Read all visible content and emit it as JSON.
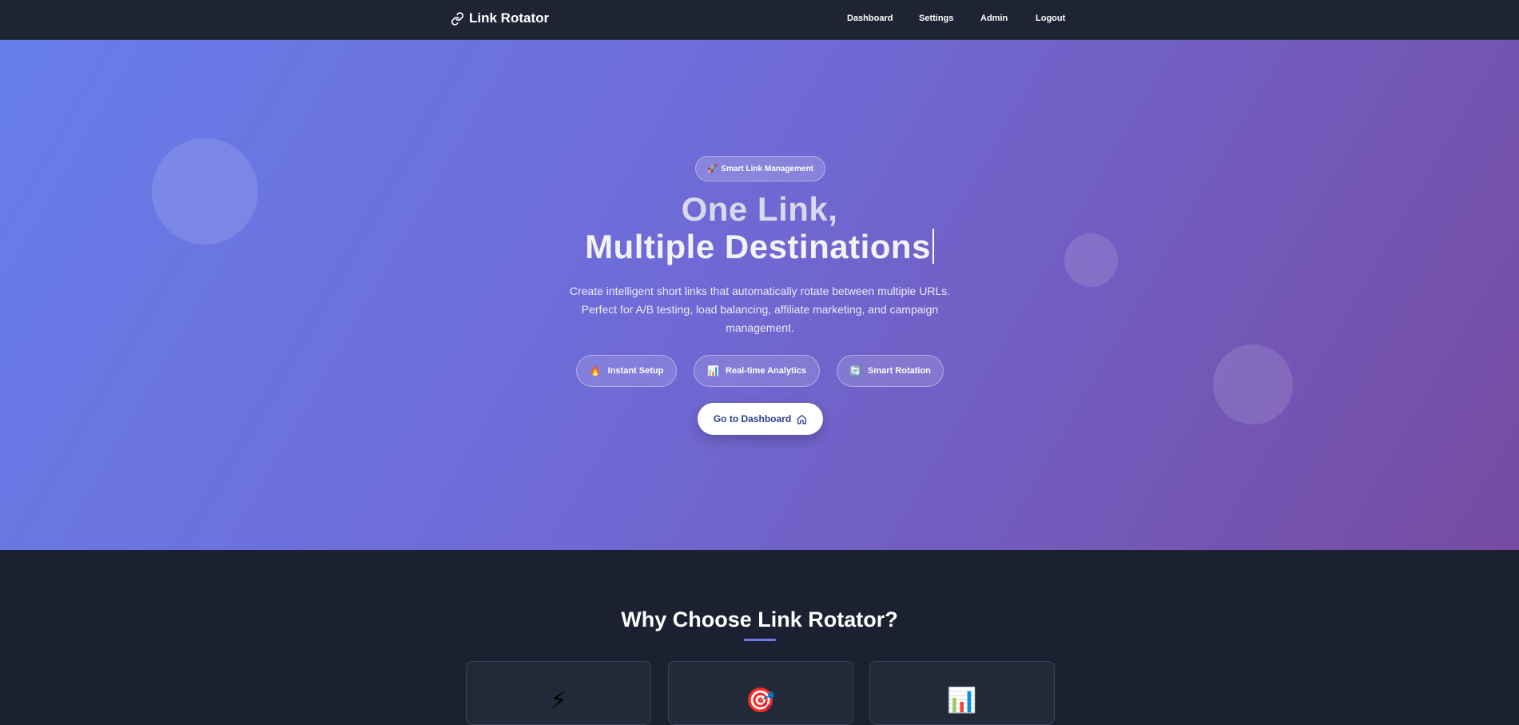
{
  "nav": {
    "brand": "Link Rotator",
    "brand_icon": "link-icon",
    "links": [
      "Dashboard",
      "Settings",
      "Admin",
      "Logout"
    ]
  },
  "hero": {
    "badge": {
      "icon": "🚀",
      "label": "Smart Link Management"
    },
    "headline_line1": "One Link,",
    "headline_line2": "Multiple Destinations",
    "lead": "Create intelligent short links that automatically rotate between multiple URLs. Perfect for A/B testing, load balancing, affiliate marketing, and campaign management.",
    "features": [
      {
        "icon": "🔥",
        "label": "Instant Setup"
      },
      {
        "icon": "📊",
        "label": "Real-time Analytics"
      },
      {
        "icon": "🔄",
        "label": "Smart Rotation"
      }
    ],
    "cta": {
      "label": "Go to Dashboard",
      "icon": "home-icon"
    }
  },
  "why": {
    "title": "Why Choose Link Rotator?",
    "cards": [
      {
        "icon": "⚡"
      },
      {
        "icon": "🎯"
      },
      {
        "icon": "📊"
      }
    ]
  },
  "colors": {
    "nav_bg": "#1e2433",
    "hero_gradient_start": "#667eea",
    "hero_gradient_end": "#764ba2",
    "section_bg": "#1b2130",
    "accent": "#6b7ce8",
    "cta_text": "#2c3e8f"
  }
}
